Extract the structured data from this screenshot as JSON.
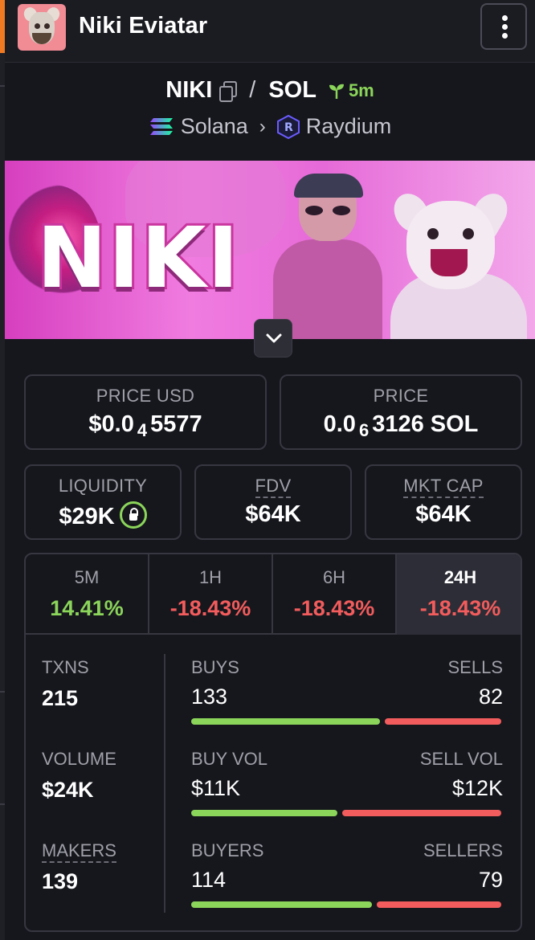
{
  "header": {
    "title": "Niki Eviatar"
  },
  "pair": {
    "base": "NIKI",
    "slash": "/",
    "quote": "SOL",
    "age": "5m",
    "chain": "Solana",
    "dex": "Raydium"
  },
  "banner": {
    "logo_text": "NIKI"
  },
  "price_usd": {
    "label": "PRICE USD",
    "prefix": "$0.0",
    "zeros": "4",
    "digits": "5577"
  },
  "price_sol": {
    "label": "PRICE",
    "prefix": "0.0",
    "zeros": "6",
    "digits": "3126 SOL"
  },
  "liquidity": {
    "label": "LIQUIDITY",
    "value": "$29K"
  },
  "fdv": {
    "label": "FDV",
    "value": "$64K"
  },
  "mkt_cap": {
    "label": "MKT CAP",
    "value": "$64K"
  },
  "timeframes": [
    {
      "label": "5M",
      "change": "14.41%"
    },
    {
      "label": "1H",
      "change": "-18.43%"
    },
    {
      "label": "6H",
      "change": "-18.43%"
    },
    {
      "label": "24H",
      "change": "-18.43%",
      "active": true
    }
  ],
  "stats": {
    "txns": {
      "label": "TXNS",
      "value": "215"
    },
    "buys": {
      "label": "BUYS",
      "value": "133"
    },
    "sells": {
      "label": "SELLS",
      "value": "82"
    },
    "volume": {
      "label": "VOLUME",
      "value": "$24K"
    },
    "buy_vol": {
      "label": "BUY VOL",
      "value": "$11K"
    },
    "sell_vol": {
      "label": "SELL VOL",
      "value": "$12K"
    },
    "makers": {
      "label": "MAKERS",
      "value": "139"
    },
    "buyers": {
      "label": "BUYERS",
      "value": "114"
    },
    "sellers": {
      "label": "SELLERS",
      "value": "79"
    }
  },
  "ratios": {
    "buys_share": 0.619,
    "buy_vol_share": 0.478,
    "buyers_share": 0.591
  },
  "colors": {
    "positive": "#8bd55a",
    "negative": "#f25c5c",
    "accent_orange": "#f07a22",
    "background": "#16171d"
  }
}
